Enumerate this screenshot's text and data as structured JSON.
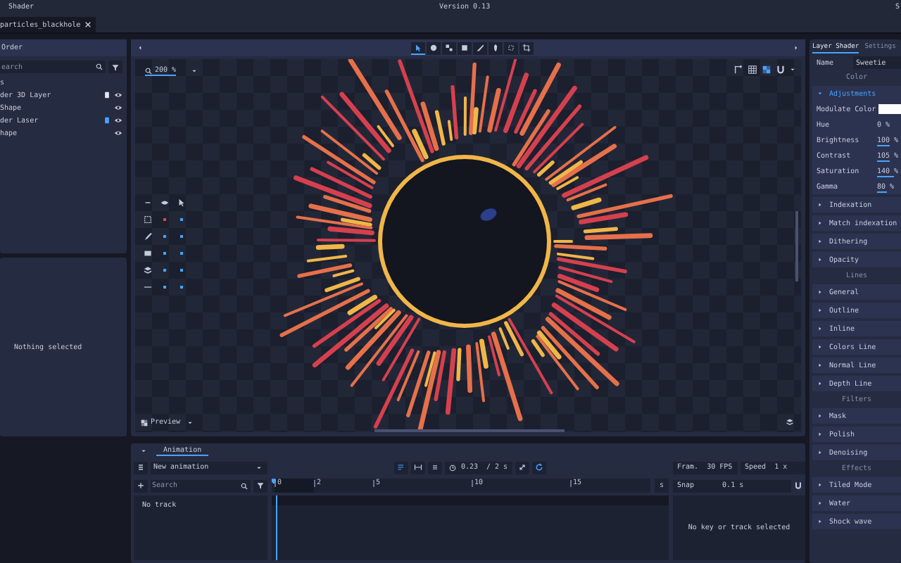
{
  "window": {
    "title": "Shader",
    "version": "Version 0.13",
    "right_text": "S"
  },
  "tabs": [
    {
      "label": "particles_blackhole",
      "selected": true
    }
  ],
  "order_panel": {
    "title": "Order",
    "search": {
      "placeholder": "earch"
    },
    "items": [
      {
        "label": "s"
      },
      {
        "label": "der 3D Layer",
        "visible": true,
        "badge": {
          "selected": false
        }
      },
      {
        "label": "Shape",
        "visible": true
      },
      {
        "label": "der Laser",
        "visible": true,
        "badge": {
          "selected": true
        }
      },
      {
        "label": "hape",
        "visible": true
      }
    ]
  },
  "selection_panel": {
    "message": "Nothing selected"
  },
  "canvas": {
    "zoom": "200 %",
    "tools": [
      {
        "kind": "select",
        "selected": true
      },
      {
        "kind": "paint",
        "selected": false
      },
      {
        "kind": "move",
        "selected": false
      },
      {
        "kind": "rect",
        "selected": false
      },
      {
        "kind": "brush",
        "selected": false
      },
      {
        "kind": "pin",
        "selected": false
      },
      {
        "kind": "transform",
        "selected": false
      },
      {
        "kind": "crop",
        "selected": false
      }
    ],
    "view_buttons": [
      {
        "kind": "axes",
        "selected": false
      },
      {
        "kind": "grid",
        "selected": false
      },
      {
        "kind": "checker",
        "selected": true
      },
      {
        "kind": "magnet",
        "selected": false
      }
    ],
    "layer_rows": [
      {
        "kind": "selection",
        "dots": [
          {
            "color": "#e0454f"
          },
          {
            "color": "#3fa8ff"
          }
        ]
      },
      {
        "kind": "brush",
        "dots": [
          {
            "color": "#3fa8ff"
          },
          {
            "color": "#3fa8ff"
          }
        ]
      },
      {
        "kind": "image",
        "dots": [
          {
            "color": "#3fa8ff"
          },
          {
            "color": "#3fa8ff"
          }
        ]
      },
      {
        "kind": "stack",
        "dots": [
          {
            "color": "#3fa8ff"
          },
          {
            "color": "#3fa8ff"
          }
        ]
      },
      {
        "kind": "line",
        "dots": [
          {
            "color": "#3fa8ff"
          },
          {
            "color": "#3fa8ff"
          }
        ]
      }
    ],
    "preview": "Preview"
  },
  "animation": {
    "tab": "Animation",
    "name": "New animation",
    "controls": [
      {
        "kind": "loop",
        "selected": true
      },
      {
        "kind": "step",
        "selected": false
      },
      {
        "kind": "stop",
        "selected": false
      }
    ],
    "time": "0.23",
    "duration": "/ 2 s",
    "fps_label": "Fram.",
    "fps": "30 FPS",
    "speed_label": "Speed",
    "speed": "1 x",
    "search": {
      "placeholder": "Search"
    },
    "empty_tracks": "No track",
    "ticks": [
      "0",
      "2",
      "5",
      "10",
      "15"
    ],
    "unit": "s",
    "snap_label": "Snap",
    "snap": "0.1 s",
    "empty_keys": "No key or track selected"
  },
  "inspector": {
    "tabs": [
      {
        "label": "Layer Shader",
        "selected": true
      },
      {
        "label": "Settings",
        "selected": false
      }
    ],
    "name_label": "Name",
    "name_value": "Sweetie",
    "sections": [
      {
        "title": "Color",
        "groups": [
          {
            "title": "Adjustments",
            "expanded": true,
            "props": [
              {
                "kind": "color",
                "label": "Modulate Color",
                "color": "#ffffff"
              },
              {
                "kind": "slider",
                "label": "Hue",
                "value": "0 %"
              },
              {
                "kind": "slider",
                "label": "Brightness",
                "value": "100 %",
                "level": 0.5
              },
              {
                "kind": "slider",
                "label": "Contrast",
                "value": "105 %",
                "level": 0.52
              },
              {
                "kind": "slider",
                "label": "Saturation",
                "value": "140 %",
                "level": 0.7
              },
              {
                "kind": "slider",
                "label": "Gamma",
                "value": "80 %",
                "level": 0.4
              }
            ]
          },
          {
            "title": "Indexation",
            "expanded": false
          },
          {
            "title": "Match indexation",
            "expanded": false
          },
          {
            "title": "Dithering",
            "expanded": false
          },
          {
            "title": "Opacity",
            "expanded": false
          }
        ]
      },
      {
        "title": "Lines",
        "groups": [
          {
            "title": "General",
            "expanded": false
          },
          {
            "title": "Outline",
            "expanded": false
          },
          {
            "title": "Inline",
            "expanded": false
          },
          {
            "title": "Colors Line",
            "expanded": false
          },
          {
            "title": "Normal Line",
            "expanded": false
          },
          {
            "title": "Depth Line",
            "expanded": false
          }
        ]
      },
      {
        "title": "Filters",
        "groups": [
          {
            "title": "Mask",
            "expanded": false
          },
          {
            "title": "Polish",
            "expanded": false
          },
          {
            "title": "Denoising",
            "expanded": false
          }
        ]
      },
      {
        "title": "Effects",
        "groups": [
          {
            "title": "Tiled Mode",
            "expanded": false
          },
          {
            "title": "Water",
            "expanded": false
          },
          {
            "title": "Shock wave",
            "expanded": false
          }
        ]
      }
    ]
  }
}
